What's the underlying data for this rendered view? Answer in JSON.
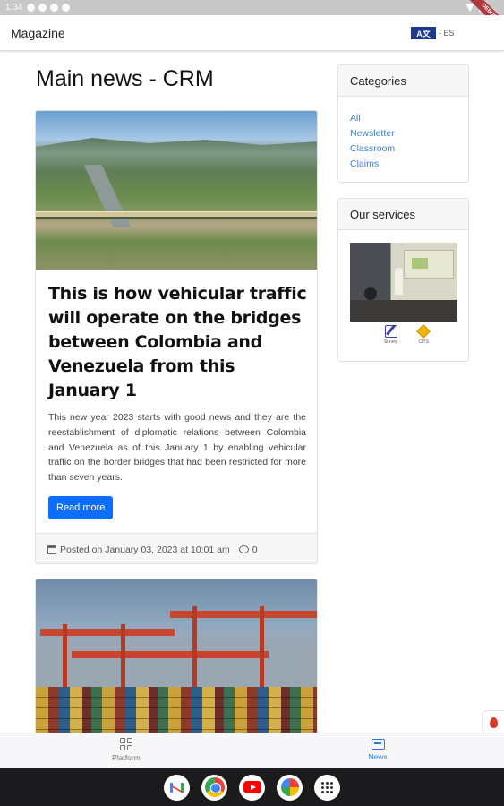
{
  "status_bar": {
    "time": "1:34"
  },
  "debug_banner": {
    "text": "DEBUG"
  },
  "app_bar": {
    "title": "Magazine",
    "language_flag": "A文",
    "language_code": "- ES"
  },
  "main": {
    "title": "Main news - CRM",
    "articles": [
      {
        "image_icon": "bridge-photo",
        "headline": "This is how vehicular traffic will operate on the bridges between Colombia and Venezuela from this January 1",
        "excerpt": "This new year 2023 starts with good news and they are the reestablishment of diplomatic relations between Colombia and Venezuela as of this January 1 by enabling vehicular traffic on the border bridges that had been restricted for more than seven years.",
        "read_more_label": "Read more",
        "posted_label": "Posted on January 03, 2023 at 10:01 am",
        "comment_count": "0"
      },
      {
        "image_icon": "port-cranes-photo"
      }
    ]
  },
  "sidebar": {
    "categories": {
      "title": "Categories",
      "items": [
        "All",
        "Newsletter",
        "Classroom",
        "Claims"
      ]
    },
    "services": {
      "title": "Our services",
      "image_icon": "classroom-photo",
      "items": [
        {
          "icon": "survey-icon",
          "label": "Survey"
        },
        {
          "icon": "box-icon",
          "label": "CITS"
        }
      ]
    }
  },
  "bottom_nav": {
    "items": [
      {
        "icon": "platform-icon",
        "label": "Platform",
        "active": false
      },
      {
        "icon": "news-icon",
        "label": "News",
        "active": true
      }
    ]
  },
  "dock": {
    "apps": [
      "gmail-icon",
      "chrome-icon",
      "youtube-icon",
      "photos-icon",
      "app-drawer-icon"
    ]
  },
  "colors": {
    "accent": "#0d6efd",
    "link": "#3b7dd8",
    "active_nav": "#2a7ad8",
    "dock_bg": "#1b1b1d"
  }
}
